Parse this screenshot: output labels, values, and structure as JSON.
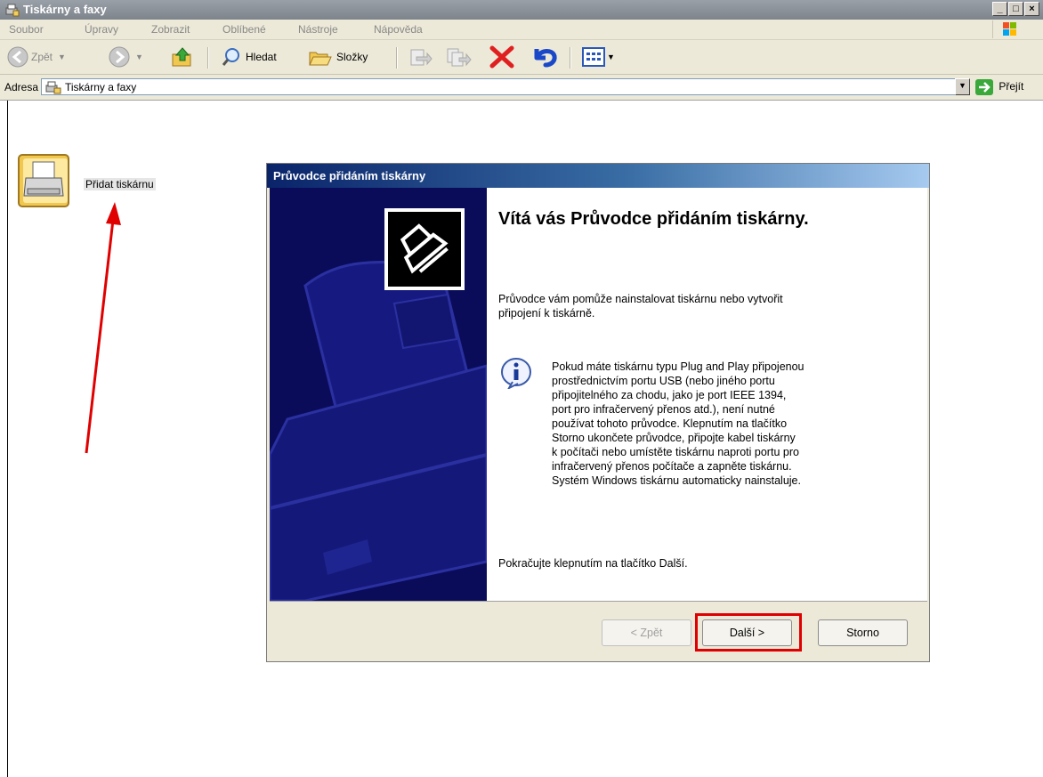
{
  "window": {
    "title": "Tiskárny a faxy"
  },
  "menu": [
    "Soubor",
    "Úpravy",
    "Zobrazit",
    "Oblíbené",
    "Nástroje",
    "Nápověda"
  ],
  "toolbar": {
    "back": "Zpět",
    "search": "Hledat",
    "folders": "Složky"
  },
  "address": {
    "label": "Adresa",
    "value": "Tiskárny a faxy",
    "go": "Přejít"
  },
  "content": {
    "add_printer": "Přidat tiskárnu"
  },
  "dialog": {
    "title": "Průvodce přidáním tiskárny",
    "heading": "Vítá vás Průvodce přidáním tiskárny.",
    "intro_line1": "Průvodce vám pomůže nainstalovat tiskárnu nebo vytvořit",
    "intro_line2": "připojení k tiskárně.",
    "info_lines": [
      "Pokud máte tiskárnu typu Plug and Play připojenou",
      "prostřednictvím portu USB (nebo jiného portu",
      "připojitelného za chodu, jako je port IEEE 1394,",
      "port pro infračervený přenos atd.), není nutné",
      "používat tohoto průvodce. Klepnutím na tlačítko",
      "Storno ukončete průvodce, připojte kabel tiskárny",
      "k počítači nebo umístěte tiskárnu naproti portu pro",
      "infračervený přenos počítače a zapněte tiskárnu.",
      "Systém Windows tiskárnu automaticky nainstaluje."
    ],
    "continue": "Pokračujte klepnutím na tlačítko Další.",
    "buttons": {
      "back": "< Zpět",
      "next": "Další >",
      "cancel": "Storno"
    }
  },
  "colors": {
    "highlight": "#e00000",
    "wizard_side": "#0a0c5a",
    "title_gradient_start": "#0a246a"
  }
}
